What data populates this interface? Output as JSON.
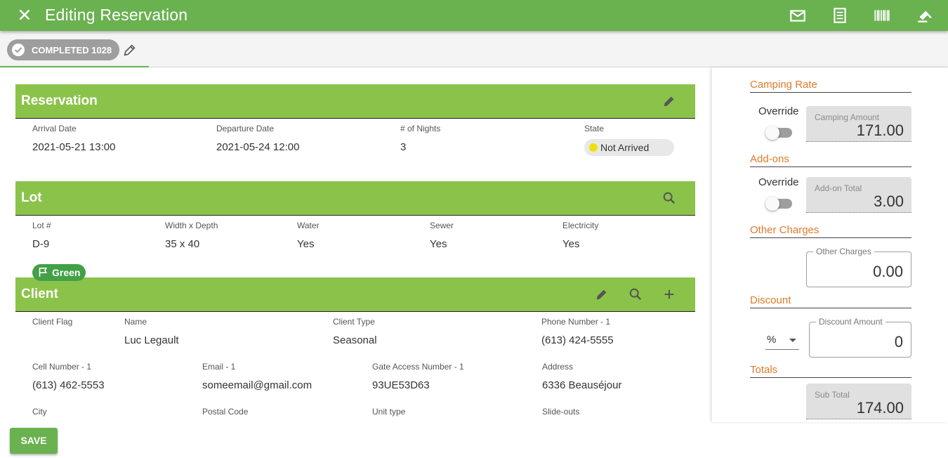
{
  "header": {
    "title": "Editing Reservation"
  },
  "status_chip": {
    "label": "COMPLETED 1028"
  },
  "reservation": {
    "title": "Reservation",
    "fields": {
      "arrival_label": "Arrival Date",
      "arrival_value": "2021-05-21 13:00",
      "departure_label": "Departure Date",
      "departure_value": "2021-05-24 12:00",
      "nights_label": "# of Nights",
      "nights_value": "3",
      "state_label": "State",
      "state_value": "Not Arrived"
    }
  },
  "lot": {
    "title": "Lot",
    "fields": {
      "lot_label": "Lot #",
      "lot_value": "D-9",
      "size_label": "Width x Depth",
      "size_value": "35 x 40",
      "water_label": "Water",
      "water_value": "Yes",
      "sewer_label": "Sewer",
      "sewer_value": "Yes",
      "electricity_label": "Electricity",
      "electricity_value": "Yes"
    }
  },
  "client": {
    "title": "Client",
    "fields": {
      "flag_label": "Client Flag",
      "flag_value": "Green",
      "name_label": "Name",
      "name_value": "Luc Legault",
      "type_label": "Client Type",
      "type_value": "Seasonal",
      "phone_label": "Phone Number - 1",
      "phone_value": "(613) 424-5555",
      "cell_label": "Cell Number - 1",
      "cell_value": "(613) 462-5553",
      "email_label": "Email - 1",
      "email_value": "someemail@gmail.com",
      "gate_label": "Gate Access Number - 1",
      "gate_value": "93UE53D63",
      "address_label": "Address",
      "address_value": "6336 Beauséjour",
      "city_label": "City",
      "postal_label": "Postal Code",
      "unit_label": "Unit type",
      "slideouts_label": "Slide-outs"
    }
  },
  "totals_panel": {
    "camping_rate": {
      "title": "Camping Rate",
      "override_label": "Override",
      "field_label": "Camping Amount",
      "value": "171.00"
    },
    "addons": {
      "title": "Add-ons",
      "override_label": "Override",
      "field_label": "Add-on Total",
      "value": "3.00"
    },
    "other_charges": {
      "title": "Other Charges",
      "field_label": "Other Charges",
      "value": "0.00"
    },
    "discount": {
      "title": "Discount",
      "type_value": "%",
      "field_label": "Discount Amount",
      "value": "0"
    },
    "totals": {
      "title": "Totals",
      "field_label": "Sub Total",
      "value": "174.00"
    }
  },
  "footer": {
    "save_label": "SAVE"
  },
  "colors": {
    "header": "#6ab150",
    "card_header": "#8bc34a",
    "section_title": "#e07b2a",
    "chip": "#9e9e9e",
    "flag_green": "#43a047"
  }
}
